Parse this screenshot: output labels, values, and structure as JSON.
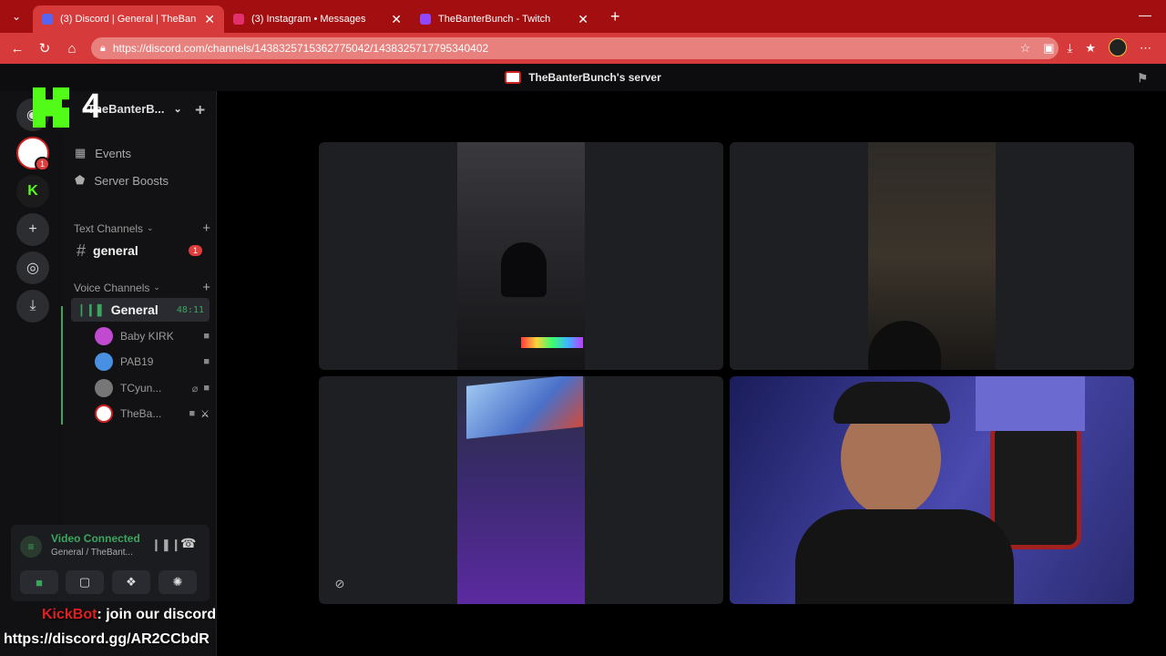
{
  "browser": {
    "tabs": [
      {
        "title": "(3) Discord | General | TheBan",
        "color": "#5865f2",
        "active": true
      },
      {
        "title": "(3) Instagram • Messages",
        "color": "#e1306c",
        "active": false
      },
      {
        "title": "TheBanterBunch - Twitch",
        "color": "#9146ff",
        "active": false
      }
    ],
    "url": "https://discord.com/channels/1438325715362775042/1438325717795340402"
  },
  "discord": {
    "header_title": "TheBanterBunch's server",
    "server_name": "TheBanterB...",
    "overlay_number": "4",
    "guild_badge": "1",
    "menu": [
      {
        "label": "Events",
        "icon": "calendar-icon"
      },
      {
        "label": "Server Boosts",
        "icon": "boost-icon"
      }
    ],
    "text_category": "Text Channels",
    "text_channels": [
      {
        "name": "general",
        "unread": "1"
      }
    ],
    "voice_category": "Voice Channels",
    "voice_channel": {
      "name": "General",
      "timer": "48:11"
    },
    "voice_users": [
      {
        "name": "Baby KIRK",
        "avatar_color": "#c04bd0"
      },
      {
        "name": "PAB19",
        "avatar_color": "#4a90e2"
      },
      {
        "name": "TCyun...",
        "avatar_color": "#777777"
      },
      {
        "name": "TheBa...",
        "avatar_color": "#ffffff"
      }
    ],
    "voice_connection": {
      "status": "Video Connected",
      "location": "General / TheBant..."
    }
  },
  "overlay": {
    "bot_name": "KickBot",
    "message": ": join our discord",
    "link": "https://discord.gg/AR2CCbdR"
  },
  "colors": {
    "tabbar": "#a30e11",
    "accent_green": "#3ba55d",
    "kick_green": "#53fc18"
  }
}
